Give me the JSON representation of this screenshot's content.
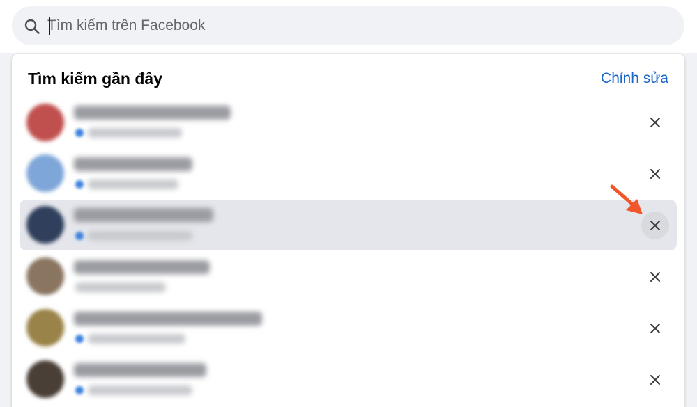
{
  "search": {
    "placeholder": "Tìm kiếm trên Facebook",
    "value": ""
  },
  "recent": {
    "title": "Tìm kiếm gần đây",
    "edit_label": "Chỉnh sửa",
    "items": [
      {
        "avatar_color": "#c0504d",
        "highlighted": false
      },
      {
        "avatar_color": "#7ea6d8",
        "highlighted": false
      },
      {
        "avatar_color": "#2f3f5c",
        "highlighted": true
      },
      {
        "avatar_color": "#8a7560",
        "highlighted": false
      },
      {
        "avatar_color": "#9a8348",
        "highlighted": false
      },
      {
        "avatar_color": "#4a3f36",
        "highlighted": false
      }
    ]
  },
  "colors": {
    "accent": "#1a66c9",
    "annotation_arrow": "#f0562a",
    "hover_row": "#e4e6eb"
  },
  "icons": {
    "search": "search-icon",
    "remove": "close-icon",
    "annotation": "arrow-annotation"
  }
}
